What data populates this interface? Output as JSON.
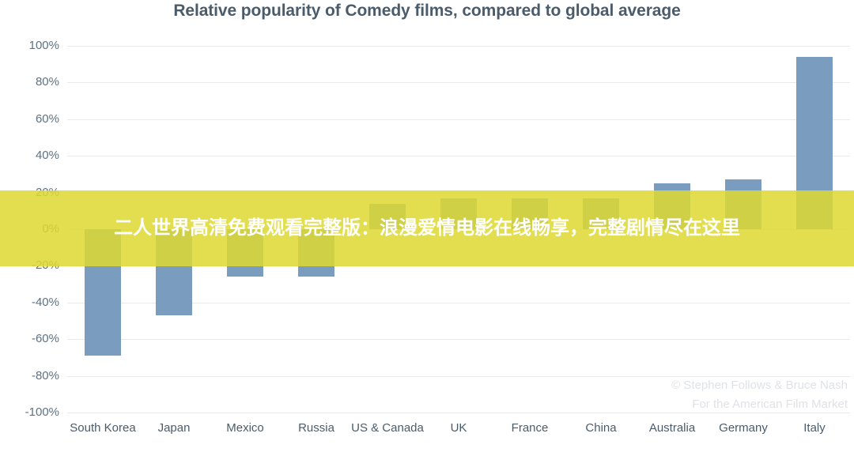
{
  "chart_data": {
    "type": "bar",
    "title": "Relative popularity of Comedy films, compared to global average",
    "xlabel": "",
    "ylabel": "",
    "ylim": [
      -100,
      100
    ],
    "ytick_step": 20,
    "grid": true,
    "legend": "none",
    "bar_color": "#7a9dbf",
    "categories": [
      "South Korea",
      "Japan",
      "Mexico",
      "Russia",
      "US & Canada",
      "UK",
      "France",
      "China",
      "Australia",
      "Germany",
      "Italy"
    ],
    "values": [
      -69,
      -47,
      -26,
      -26,
      14,
      17,
      17,
      17,
      25,
      27,
      94
    ],
    "ytick_labels": [
      "100%",
      "80%",
      "60%",
      "40%",
      "20%",
      "0%",
      "-20%",
      "-40%",
      "-60%",
      "-80%",
      "-100%"
    ],
    "ytick_values": [
      100,
      80,
      60,
      40,
      20,
      0,
      -20,
      -40,
      -60,
      -80,
      -100
    ]
  },
  "credit": {
    "line1": "© Stephen Follows & Bruce Nash",
    "line2": "For the American Film Market"
  },
  "overlay": {
    "text": "二人世界高清免费观看完整版：浪漫爱情电影在线畅享，完整剧情尽在这里",
    "background_color": "#ddd832",
    "text_color": "#ffffff"
  },
  "colors": {
    "bar": "#7a9dbf",
    "title": "#4a5c6b",
    "axis_text": "#5e7181",
    "gridline": "#e9e9ec",
    "credit": "#dfe2e6",
    "background": "#ffffff"
  }
}
